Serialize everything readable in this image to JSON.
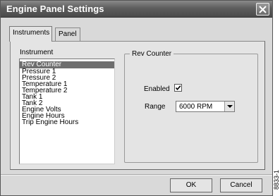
{
  "window": {
    "title": "Engine Panel Settings"
  },
  "tabs": [
    {
      "label": "Instruments",
      "active": true
    },
    {
      "label": "Panel",
      "active": false
    }
  ],
  "instrument_list": {
    "label": "Instrument",
    "items": [
      "Rev Counter",
      "Pressure 1",
      "Pressure 2",
      "Temperature 1",
      "Temperature 2",
      "Tank 1",
      "Tank 2",
      "Engine Volts",
      "Engine Hours",
      "Trip Engine Hours"
    ],
    "selected_index": 0
  },
  "group": {
    "title": "Rev Counter",
    "enabled_label": "Enabled",
    "enabled_checked": true,
    "range_label": "Range",
    "range_value": "6000 RPM"
  },
  "buttons": {
    "ok": "OK",
    "cancel": "Cancel"
  },
  "figure_number": "8833-1",
  "icons": {
    "close": "close-icon",
    "check": "check-icon",
    "dropdown": "chevron-down-icon"
  }
}
